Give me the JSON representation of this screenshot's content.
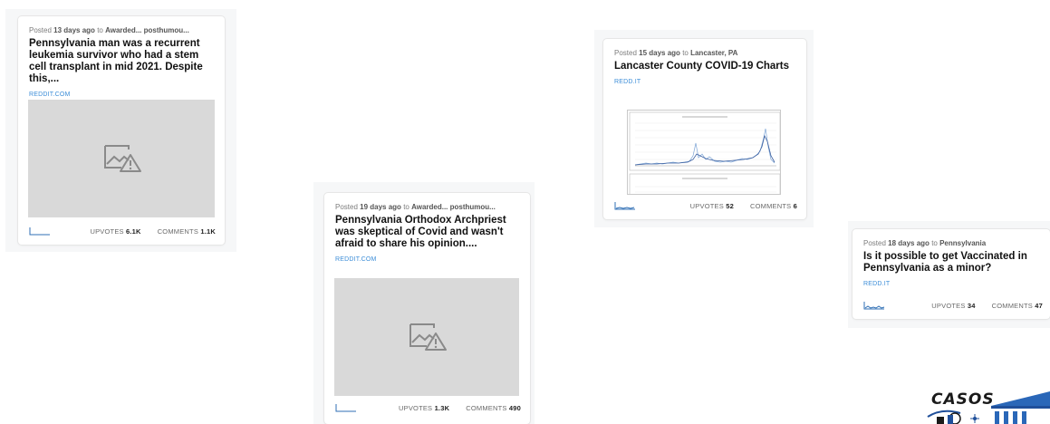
{
  "labels": {
    "posted": "Posted",
    "to": "to",
    "upvotes": "UPVOTES",
    "comments": "COMMENTS"
  },
  "posts": [
    {
      "age": "13 days ago",
      "community": "Awarded... posthumou...",
      "title": "Pennsylvania man was a recurrent leukemia survivor who had a stem cell transplant in mid 2021. Despite this,...",
      "domain": "REDDIT.COM",
      "upvotes": "6.1K",
      "comments": "1.1K",
      "thumbnail": "broken-image-icon"
    },
    {
      "age": "19 days ago",
      "community": "Awarded... posthumou...",
      "title": "Pennsylvania Orthodox Archpriest was skeptical of Covid and wasn't afraid to share his opinion....",
      "domain": "REDDIT.COM",
      "upvotes": "1.3K",
      "comments": "490",
      "thumbnail": "broken-image-icon"
    },
    {
      "age": "15 days ago",
      "community": "Lancaster, PA",
      "title": "Lancaster County COVID-19 Charts",
      "domain": "REDD.IT",
      "upvotes": "52",
      "comments": "6",
      "thumbnail": "covid-chart-image"
    },
    {
      "age": "18 days ago",
      "community": "Pennsylvania",
      "title": "Is it possible to get Vaccinated in Pennsylvania as a minor?",
      "domain": "REDD.IT",
      "upvotes": "34",
      "comments": "47",
      "thumbnail": ""
    }
  ],
  "logo": {
    "text": "CASOS"
  },
  "colors": {
    "link": "#3d8ed8",
    "thumb_bg": "#d9d9d9",
    "spark": "#2f6fb5"
  }
}
